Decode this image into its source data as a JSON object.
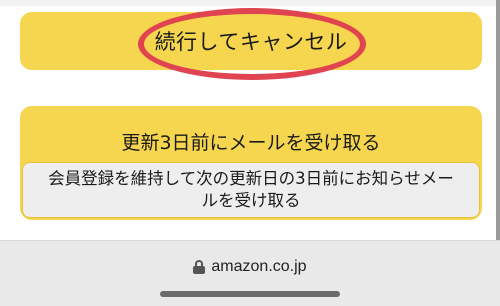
{
  "buttons": {
    "continue_cancel": "続行してキャンセル"
  },
  "reminder": {
    "title": "更新3日前にメールを受け取る",
    "description_line1": "会員登録を維持して次の更新日の3日前にお知らせメー",
    "description_line2": "ルを受け取る"
  },
  "browser": {
    "url": "amazon.co.jp",
    "url_icon": "lock-icon"
  },
  "colors": {
    "button_yellow": "#f6d64e",
    "highlight_red": "#e04451",
    "browser_bar": "#e9e9e9"
  }
}
